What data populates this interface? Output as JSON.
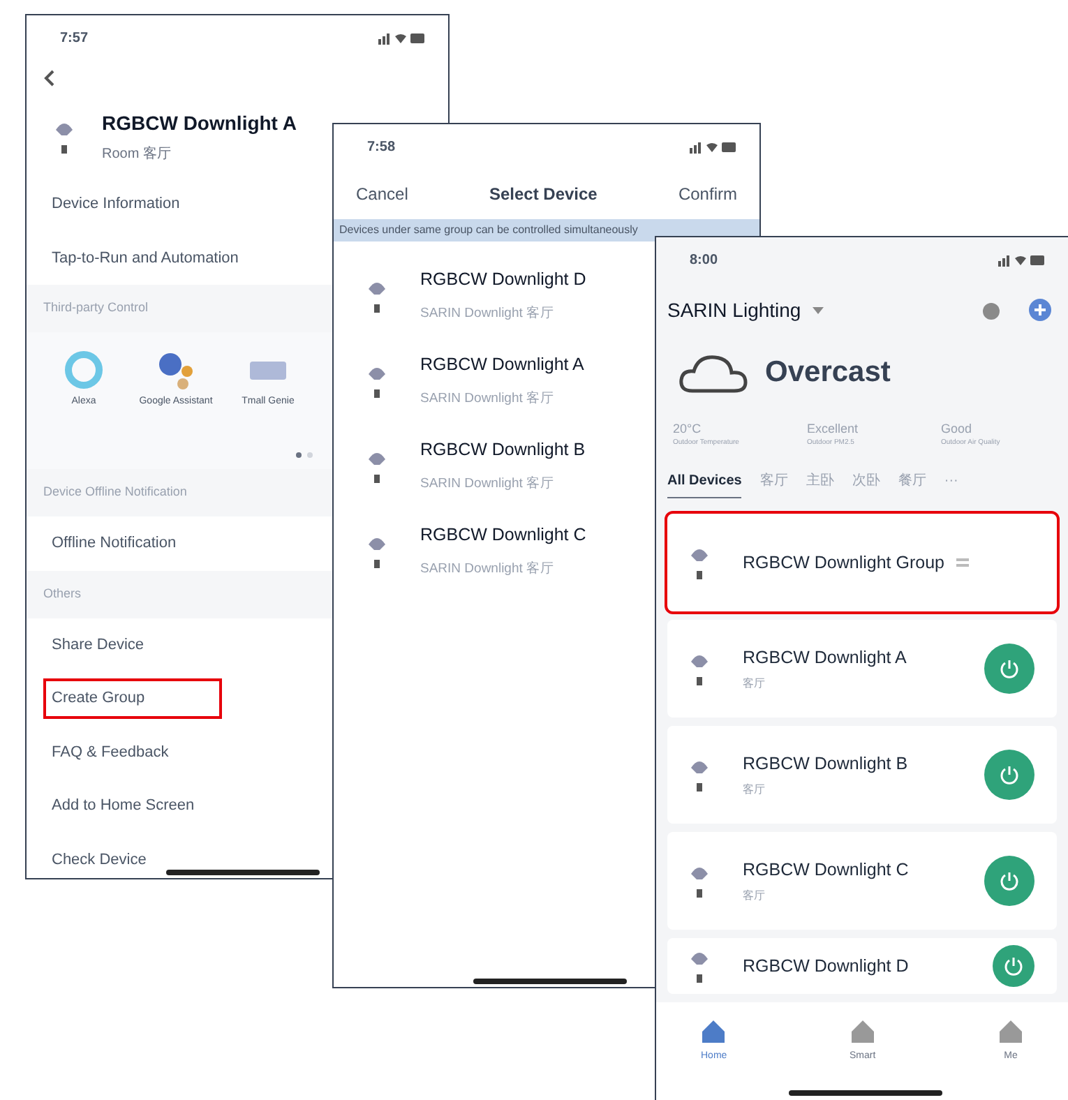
{
  "device_settings": {
    "status_time": "7:57",
    "device": {
      "name": "RGBCW Downlight A",
      "room": "Room 客厅"
    },
    "items": [
      {
        "kind": "row",
        "label": "Device Information",
        "highlighted": false
      },
      {
        "kind": "row",
        "label": "Tap-to-Run and Automation",
        "highlighted": false
      },
      {
        "kind": "section",
        "label": "Third-party Control"
      },
      {
        "kind": "services",
        "services": [
          {
            "kind": "ring",
            "label": "Alexa"
          },
          {
            "kind": "dots",
            "label": "Google Assistant"
          },
          {
            "kind": "speaker",
            "label": "Tmall Genie"
          }
        ],
        "pager": [
          {
            "selected": true
          },
          {
            "selected": false
          }
        ]
      },
      {
        "kind": "section",
        "label": "Device Offline Notification"
      },
      {
        "kind": "row",
        "label": "Offline Notification",
        "highlighted": false
      },
      {
        "kind": "section",
        "label": "Others"
      },
      {
        "kind": "row",
        "label": "Share Device",
        "highlighted": false
      },
      {
        "kind": "row",
        "label": "Create Group",
        "highlighted": true
      },
      {
        "kind": "row",
        "label": "FAQ & Feedback",
        "highlighted": false
      },
      {
        "kind": "row",
        "label": "Add to Home Screen",
        "highlighted": false
      },
      {
        "kind": "row",
        "label": "Check Device",
        "highlighted": false
      }
    ]
  },
  "select_device": {
    "status_time": "7:58",
    "cancel": "Cancel",
    "title": "Select Device",
    "confirm": "Confirm",
    "notice": "Devices under same group can be controlled simultaneously",
    "devices": [
      {
        "name": "RGBCW Downlight D",
        "detail": "SARIN Downlight 客厅"
      },
      {
        "name": "RGBCW Downlight A",
        "detail": "SARIN Downlight 客厅"
      },
      {
        "name": "RGBCW Downlight B",
        "detail": "SARIN Downlight 客厅"
      },
      {
        "name": "RGBCW Downlight C",
        "detail": "SARIN Downlight 客厅"
      }
    ]
  },
  "home": {
    "status_time": "8:00",
    "home_name": "SARIN Lighting",
    "weather": "Overcast",
    "stats": [
      {
        "value": "20°C",
        "label": "Outdoor Temperature"
      },
      {
        "value": "Excellent",
        "label": "Outdoor PM2.5"
      },
      {
        "value": "Good",
        "label": "Outdoor Air Quality"
      }
    ],
    "tabs": [
      {
        "label": "All Devices",
        "selected": true
      },
      {
        "label": "客厅",
        "selected": false
      },
      {
        "label": "主卧",
        "selected": false
      },
      {
        "label": "次卧",
        "selected": false
      },
      {
        "label": "餐厅",
        "selected": false
      },
      {
        "label": "···",
        "selected": false
      }
    ],
    "devices": [
      {
        "kind": "group",
        "name": "RGBCW Downlight Group",
        "highlighted": true
      },
      {
        "kind": "device",
        "name": "RGBCW Downlight A",
        "room": "客厅",
        "on": true,
        "highlighted": false
      },
      {
        "kind": "device",
        "name": "RGBCW Downlight B",
        "room": "客厅",
        "on": true,
        "highlighted": false
      },
      {
        "kind": "device",
        "name": "RGBCW Downlight C",
        "room": "客厅",
        "on": true,
        "highlighted": false
      },
      {
        "kind": "device",
        "name": "RGBCW Downlight D",
        "on": true,
        "highlighted": false
      }
    ],
    "nav": [
      {
        "label": "Home",
        "selected": true
      },
      {
        "label": "Smart",
        "selected": false
      },
      {
        "label": "Me",
        "selected": false
      }
    ]
  }
}
